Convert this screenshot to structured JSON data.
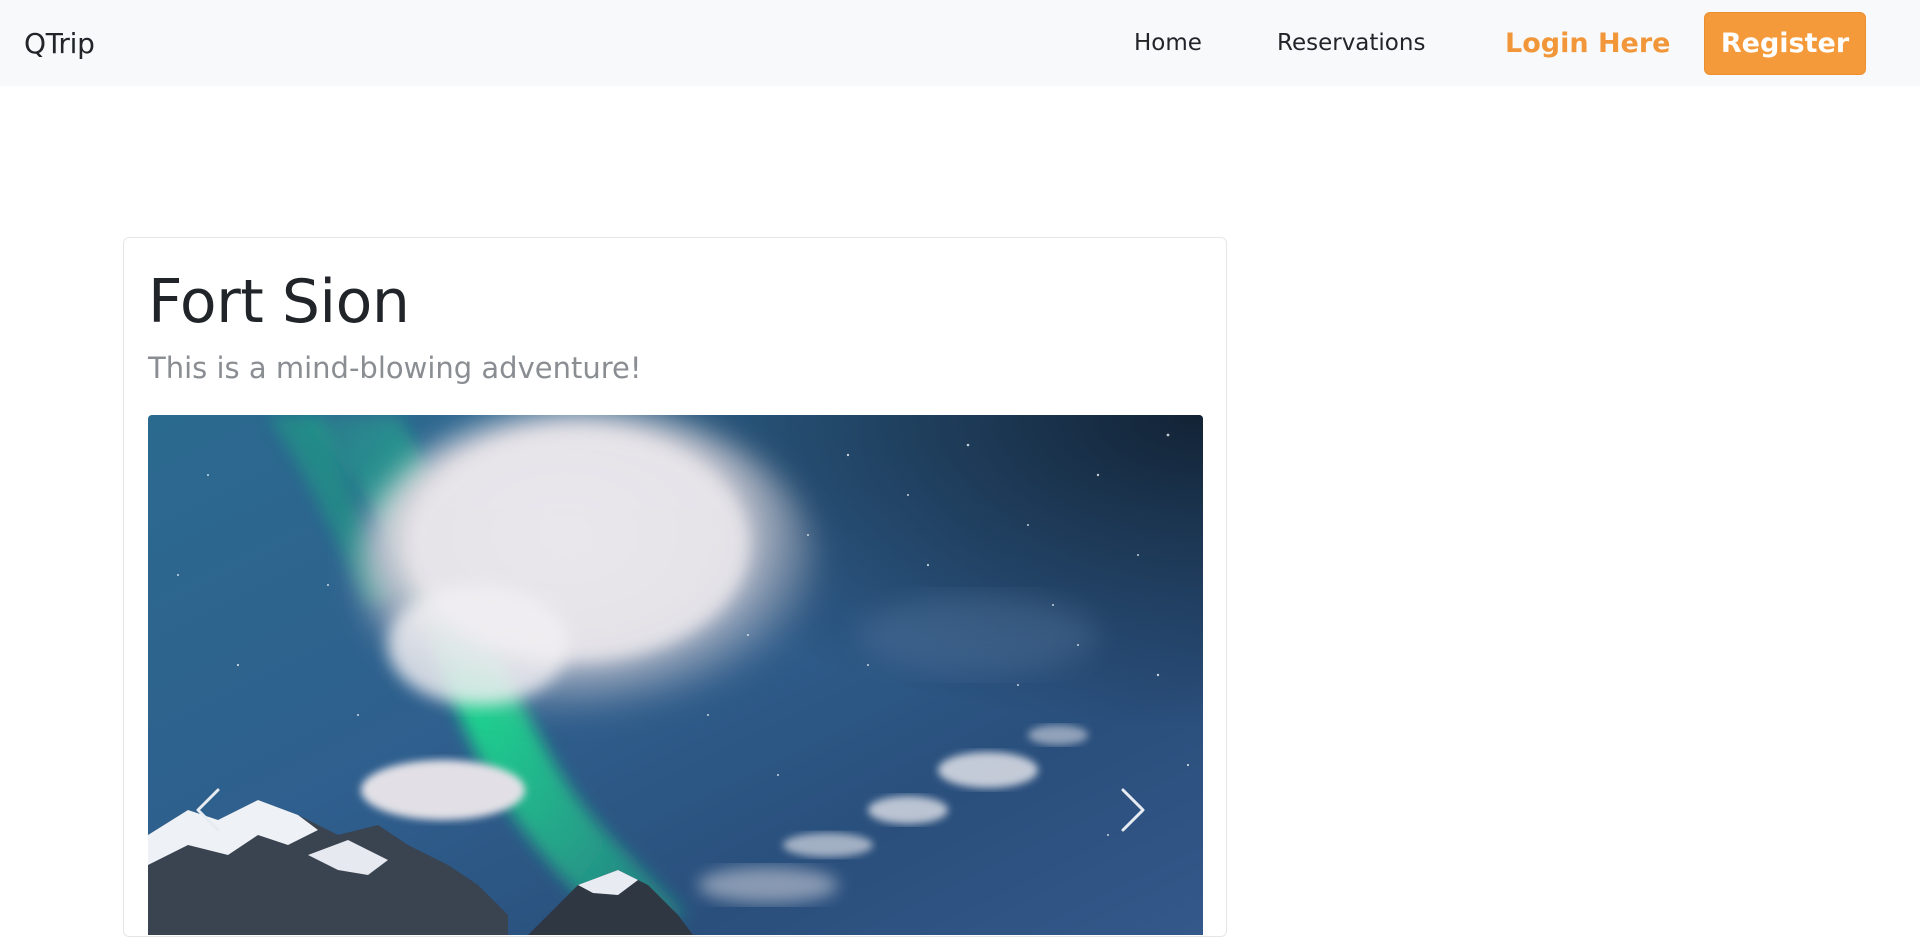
{
  "navbar": {
    "brand": "QTrip",
    "links": [
      {
        "label": "Home"
      },
      {
        "label": "Reservations"
      }
    ],
    "login_label": "Login Here",
    "register_label": "Register"
  },
  "adventure": {
    "title": "Fort Sion",
    "subtitle": "This is a mind-blowing adventure!"
  },
  "carousel": {
    "image": "aurora-night-sky-over-snowy-mountains",
    "prev_icon": "chevron-left-icon",
    "next_icon": "chevron-right-icon"
  },
  "colors": {
    "accent": "#f49a3a",
    "navbar_bg": "#f8f9fa",
    "subtitle": "#8a8e93"
  }
}
